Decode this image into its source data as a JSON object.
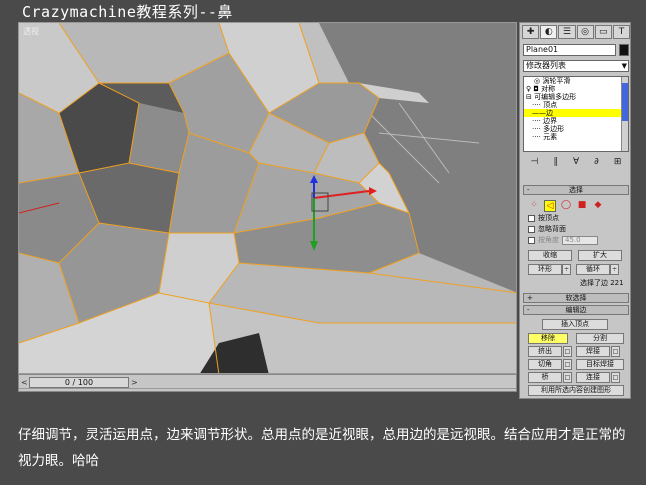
{
  "title": "Crazymachine教程系列--鼻",
  "viewport": {
    "label": "透视",
    "gizmo_axis": "x"
  },
  "timeline": {
    "frame": "0 / 100",
    "prev": "<",
    "next": ">"
  },
  "panel": {
    "tabs": [
      "✚",
      "◐",
      "☰",
      "◎",
      "▭",
      "T"
    ],
    "object_name": "Plane01",
    "modifier_list": "修改器列表",
    "stack": [
      {
        "label": "◎ 涡轮平滑",
        "selected": false
      },
      {
        "label": "♀ ◘ 对称",
        "selected": false
      },
      {
        "label": "⊟ 可编辑多边形",
        "selected": false
      },
      {
        "label": "···· 顶点",
        "selected": false
      },
      {
        "label": "——边",
        "selected": true
      },
      {
        "label": "···· 边界",
        "selected": false
      },
      {
        "label": "···· 多边形",
        "selected": false
      },
      {
        "label": "···· 元素",
        "selected": false
      }
    ],
    "stack_tools": [
      "⊣",
      "∥",
      "∀",
      "∂",
      "⊞"
    ],
    "selection": {
      "header": "选择",
      "icons": [
        "⁘",
        "◁",
        "◯",
        "■",
        "◆"
      ],
      "by_vertex": "按顶点",
      "ignore_backfacing": "忽略背面",
      "by_angle": "按角度",
      "angle_value": "45.0",
      "shrink": "收缩",
      "grow": "扩大",
      "ring": "环形",
      "loop": "循环",
      "status": "选择了边 221"
    },
    "soft_selection": "软选择",
    "edit_edges": {
      "header": "编辑边",
      "insert_vertex": "插入顶点",
      "remove": "移除",
      "split": "分割",
      "extrude": "挤出",
      "weld": "焊接",
      "chamfer": "切角",
      "target_weld": "目标焊接",
      "bridge": "桥",
      "connect": "连接",
      "create_shape": "利用所选内容创建图形"
    }
  },
  "caption": "仔细调节，灵活运用点，边来调节形状。总用点的是近视眼，总用边的是远视眼。结合应用才是正常的视力眼。哈哈"
}
